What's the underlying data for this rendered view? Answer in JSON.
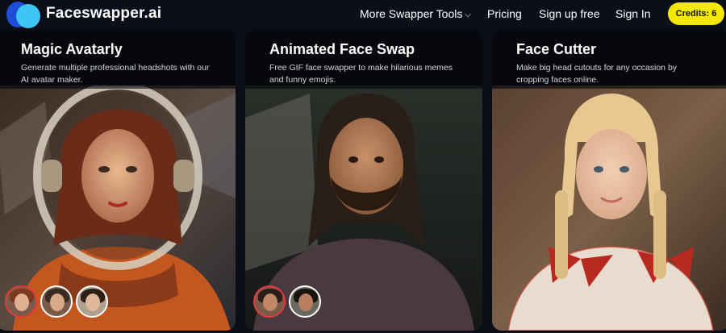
{
  "brand": {
    "name": "Faceswapper.ai"
  },
  "nav": {
    "more_tools": "More Swapper Tools",
    "pricing": "Pricing",
    "signup": "Sign up free",
    "signin": "Sign In",
    "credits": "Credits: 6"
  },
  "cards": [
    {
      "title": "Magic Avatarly",
      "desc": "Generate multiple professional headshots with our AI avatar maker."
    },
    {
      "title": "Animated Face Swap",
      "desc": "Free GIF face swapper to make hilarious memes and funny emojis."
    },
    {
      "title": "Face Cutter",
      "desc": "Make big head cutouts for any occasion by cropping faces online."
    }
  ],
  "colors": {
    "accent": "#f5e800",
    "background": "#0a0e17"
  }
}
